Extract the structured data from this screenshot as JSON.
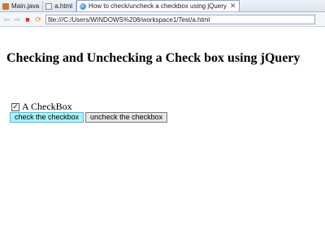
{
  "browser": {
    "tabs": [
      {
        "label": "Main.java",
        "icon": "java-file-icon",
        "active": false
      },
      {
        "label": "a.html",
        "icon": "html-file-icon",
        "active": false
      },
      {
        "label": "How to check/uncheck a checkbox using jQuery",
        "icon": "globe-icon",
        "active": true
      }
    ],
    "close_glyph": "✕",
    "address": "file:///C:/Users/WINDOWS%208/workspace1/Test/a.html",
    "nav": {
      "back": "⇦",
      "forward": "⇨",
      "stop": "■",
      "refresh": "⟳"
    }
  },
  "page": {
    "title": "Checking and Unchecking a Check box using jQuery",
    "checkbox": {
      "label": "A CheckBox",
      "checked": true,
      "glyph": "✓"
    },
    "buttons": {
      "check": "check the checkbox",
      "uncheck": "uncheck the checkbox"
    }
  },
  "colors": {
    "check_button_bg": "#a8f2ff",
    "stop_icon": "#d42a2a"
  }
}
